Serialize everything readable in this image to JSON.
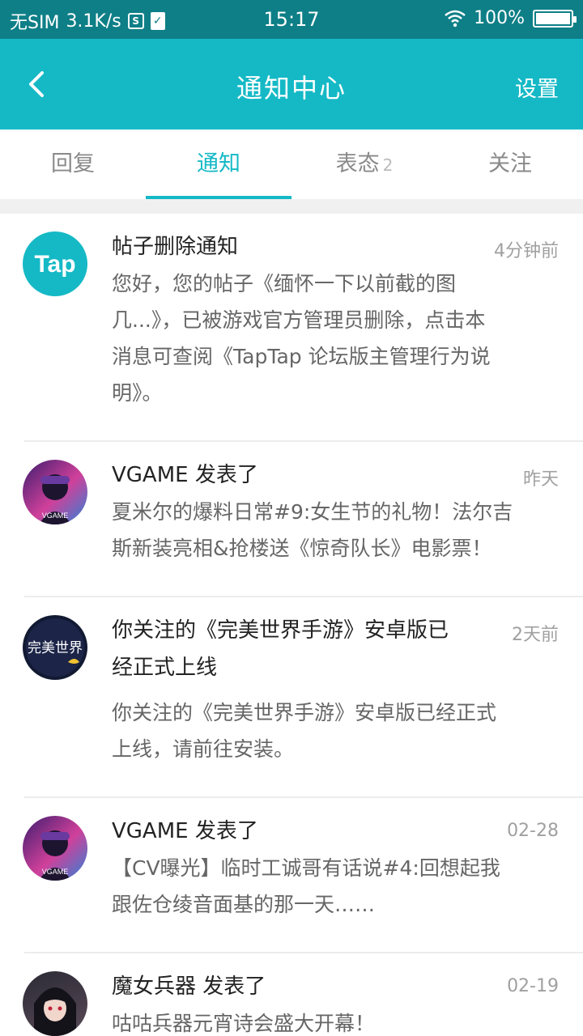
{
  "status_bar": {
    "carrier": "无SIM",
    "speed": "3.1K/s",
    "time": "15:17",
    "battery": "100%",
    "battery_level": 1.0
  },
  "header": {
    "title": "通知中心",
    "settings": "设置",
    "background_color": "#15b9c6"
  },
  "tabs": [
    {
      "label": "回复"
    },
    {
      "label": "通知",
      "active": true
    },
    {
      "label": "表态",
      "badge": "2"
    },
    {
      "label": "关注"
    }
  ],
  "notifications": [
    {
      "avatar_icon": "taptap-logo",
      "avatar_text": "Tap",
      "title": "帖子删除通知",
      "time": "4分钟前",
      "body": [
        "您好，您的帖子《缅怀一下以前截的图",
        "几...》，已被游戏官方管理员删除，点击本",
        "消息可查阅《TapTap 论坛版主管理行为说",
        "明》。"
      ]
    },
    {
      "avatar_icon": "vgame-avatar",
      "avatar_text": "VGAME",
      "title": "VGAME 发表了",
      "time": "昨天",
      "body": [
        "夏米尔的爆料日常#9:女生节的礼物！法尔吉",
        "斯新装亮相&抢楼送《惊奇队长》电影票！"
      ]
    },
    {
      "avatar_icon": "perfect-world-avatar",
      "avatar_text": "完美世界",
      "title_lines": [
        "你关注的《完美世界手游》安卓版已",
        "经正式上线"
      ],
      "time": "2天前",
      "body": [
        "你关注的《完美世界手游》安卓版已经正式",
        "上线，请前往安装。"
      ]
    },
    {
      "avatar_icon": "vgame-avatar",
      "avatar_text": "VGAME",
      "title": "VGAME 发表了",
      "time": "02-28",
      "body": [
        "【CV曝光】临时工诚哥有话说#4:回想起我",
        "跟佐仓绫音面基的那一天……"
      ]
    },
    {
      "avatar_icon": "witch-weapon-avatar",
      "title": "魔女兵器 发表了",
      "time": "02-19",
      "body": [
        "咕咕兵器元宵诗会盛大开幕！"
      ]
    }
  ]
}
